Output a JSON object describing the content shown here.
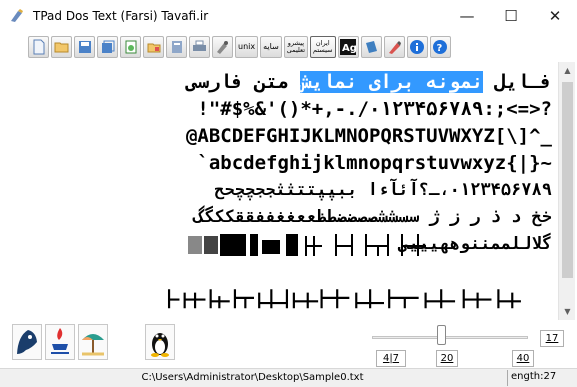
{
  "window": {
    "title": "TPad Dos Text (Farsi) Tavafi.ir",
    "controls": [
      "—",
      "☐",
      "✕"
    ]
  },
  "toolbar": {
    "icons": [
      "new-file-icon",
      "open-folder-icon",
      "save-icon",
      "save-as-icon",
      "print-preview-icon",
      "open-recent-icon",
      "export-icon",
      "print-icon",
      "settings-icon"
    ],
    "text_buttons": {
      "unix": "unix",
      "saye": "سایه",
      "pishro_1": "پیشرو",
      "pishro_2": "تعلیمی",
      "iran_1": "ایران",
      "iran_2": "سیستم"
    },
    "icons_right": [
      "font-ag-icon",
      "book-icon",
      "highlighter-icon",
      "info-icon",
      "help-icon"
    ]
  },
  "editor": {
    "line1_prefix": "فـایل ",
    "line1_selected": "نمونه برای نمایش",
    "line1_suffix": " متن فارسی",
    "line2": "!\"#$%&'()*+,-./۰۱۲۳۴۵۶۷۸۹:;<=>?",
    "line3": "@ABCDEFGHIJKLMNOPQRSTUVWXYZ[\\]^_",
    "line4": "`abcdefghijklmnopqrstuvwxyz{|}~",
    "line5": "۰۱۲۳۴۵۶۷۸۹،ـ؟آئآءا ببپپتتثثججچچحح",
    "line6": "خخ د ذ ر ز ژ سسششصصضضطظععغغففققککگگ",
    "line7": "گلاللممننوههیییی",
    "line8": "",
    "line9": ""
  },
  "bottom": {
    "os_buttons": [
      "dos-icon",
      "java-icon",
      "windows-icon",
      "linux-icon"
    ],
    "slider_value": 20,
    "box_17": "17",
    "box_47": "4|7",
    "box_20": "20",
    "box_40": "40"
  },
  "status": {
    "path": "C:\\Users\\Administrator\\Desktop\\Sample0.txt",
    "length": "ength:27"
  },
  "colors": {
    "selection": "#3399ff",
    "accent_blue": "#1e6fd9"
  }
}
